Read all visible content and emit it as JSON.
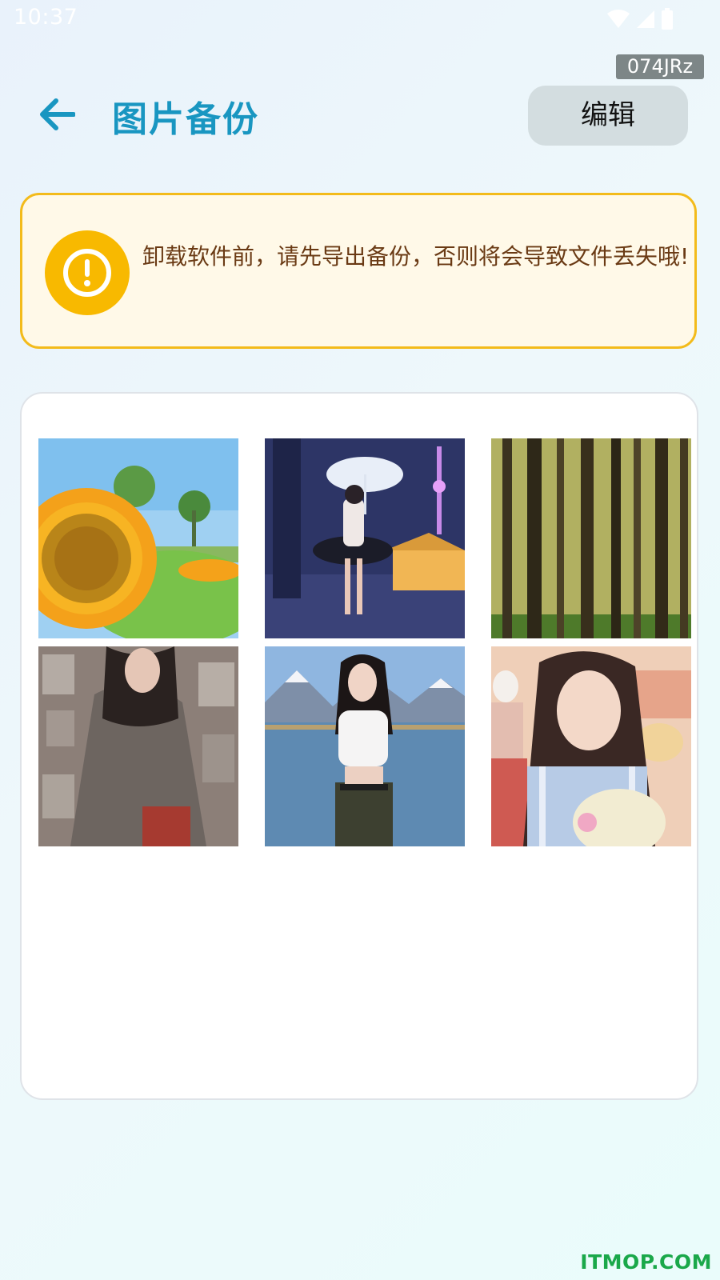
{
  "status_bar": {
    "time": "10:37"
  },
  "tag": "074JRz",
  "header": {
    "title": "图片备份",
    "edit_label": "编辑",
    "back_icon": "arrow-left-icon"
  },
  "warning": {
    "text": "卸载软件前，请先导出备份，否则将会导致文件丢失哦!",
    "icon": "exclamation-circle-icon"
  },
  "gallery": {
    "images": [
      {
        "subject": "sunflower"
      },
      {
        "subject": "girl with umbrella at night"
      },
      {
        "subject": "forest"
      },
      {
        "subject": "girl against newspaper wall"
      },
      {
        "subject": "girl by lake"
      },
      {
        "subject": "girl with plush toy"
      }
    ]
  },
  "watermark": "ITMOP.COM",
  "colors": {
    "accent": "#1996c1",
    "warning_border": "#f3bb1b",
    "warning_bg": "#fff9e8",
    "warning_icon": "#f8b900",
    "warning_text": "#6a3a14",
    "edit_bg": "#d3dde0",
    "watermark": "#1aa84a"
  }
}
